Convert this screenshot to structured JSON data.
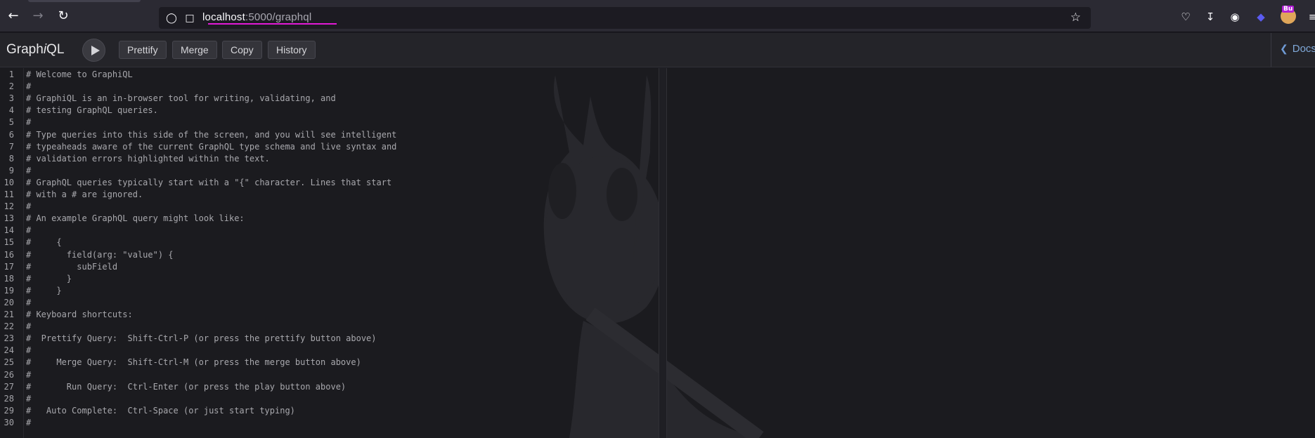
{
  "browser": {
    "url_host": "localhost",
    "url_path": ":5000/graphql"
  },
  "graphiql": {
    "title_prefix": "Graph",
    "title_italic": "i",
    "title_suffix": "QL",
    "buttons": {
      "prettify": "Prettify",
      "merge": "Merge",
      "copy": "Copy",
      "history": "History"
    },
    "docs_label": "Docs"
  },
  "editor": {
    "lines": [
      "# Welcome to GraphiQL",
      "#",
      "# GraphiQL is an in-browser tool for writing, validating, and",
      "# testing GraphQL queries.",
      "#",
      "# Type queries into this side of the screen, and you will see intelligent",
      "# typeaheads aware of the current GraphQL type schema and live syntax and",
      "# validation errors highlighted within the text.",
      "#",
      "# GraphQL queries typically start with a \"{\" character. Lines that start",
      "# with a # are ignored.",
      "#",
      "# An example GraphQL query might look like:",
      "#",
      "#     {",
      "#       field(arg: \"value\") {",
      "#         subField",
      "#       }",
      "#     }",
      "#",
      "# Keyboard shortcuts:",
      "#",
      "#  Prettify Query:  Shift-Ctrl-P (or press the prettify button above)",
      "#",
      "#     Merge Query:  Shift-Ctrl-M (or press the merge button above)",
      "#",
      "#       Run Query:  Ctrl-Enter (or press the play button above)",
      "#",
      "#   Auto Complete:  Ctrl-Space (or just start typing)",
      "#"
    ]
  },
  "extension_badge": "Bu"
}
